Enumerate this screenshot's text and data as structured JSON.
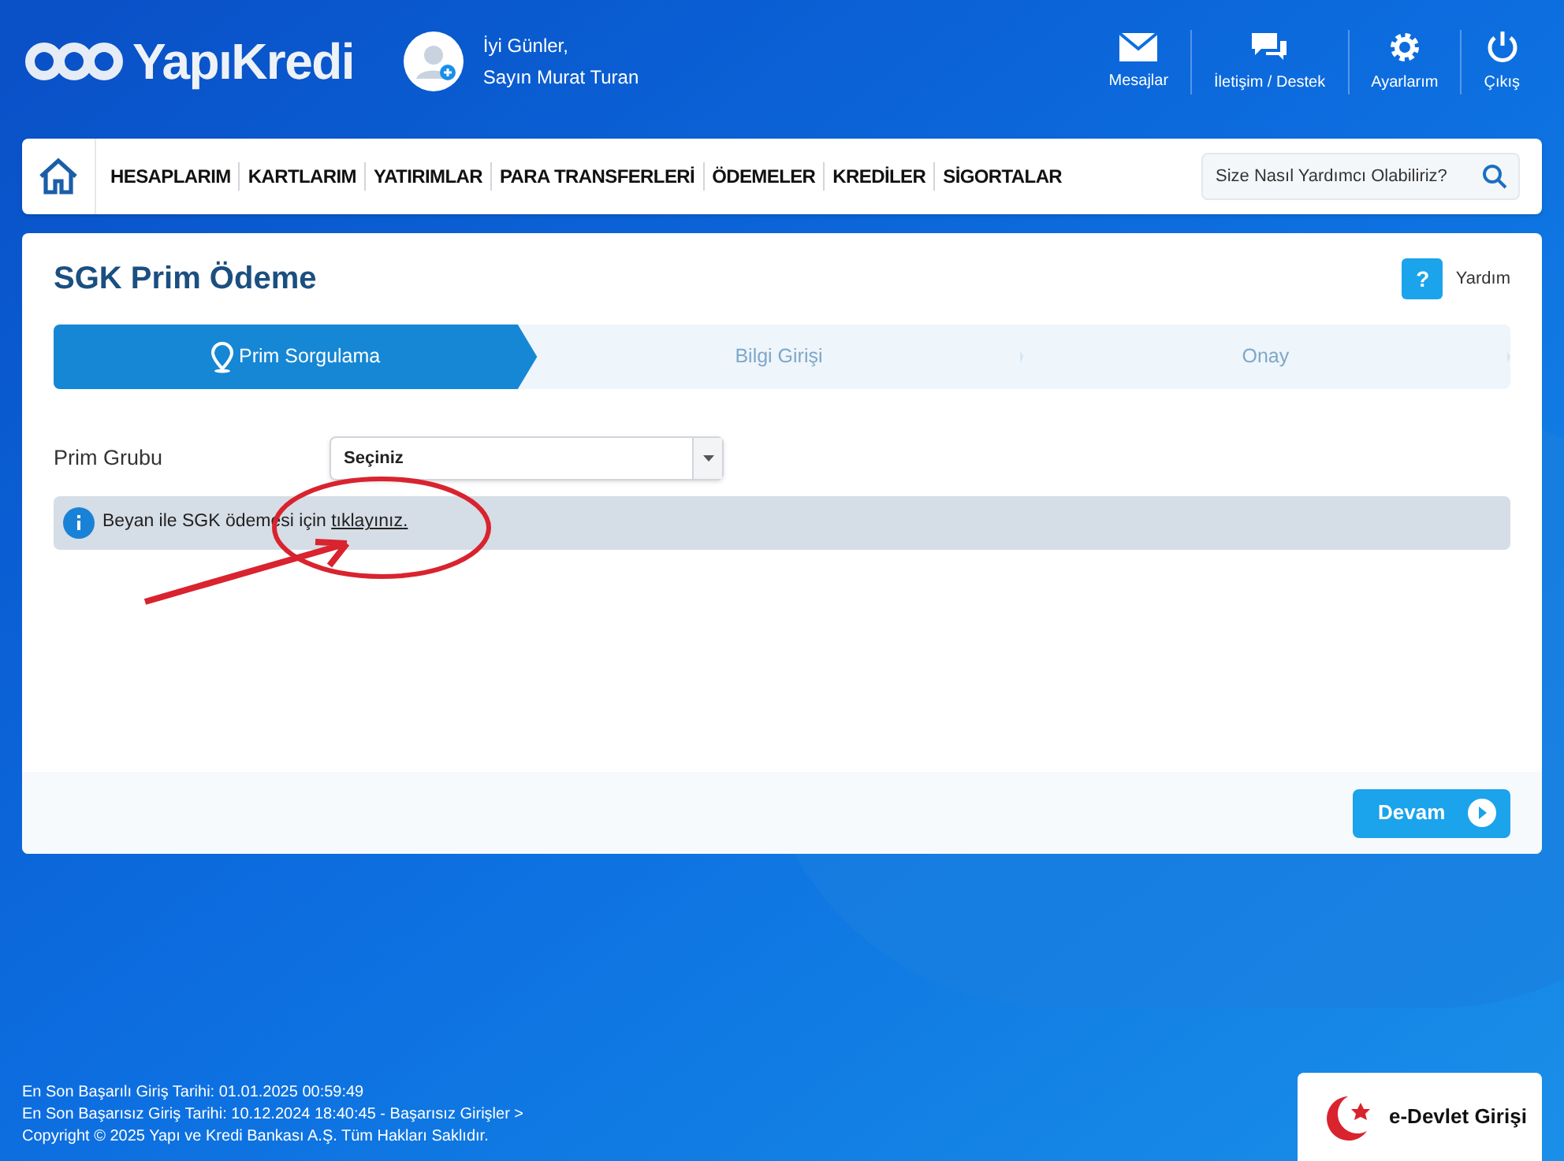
{
  "header": {
    "logo": "YapıKredi",
    "greeting": "İyi Günler,",
    "user_name": "Sayın Murat Turan",
    "actions": [
      {
        "kind": "mail",
        "label": "Mesajlar"
      },
      {
        "kind": "chat",
        "label": "İletişim / Destek"
      },
      {
        "kind": "settings",
        "label": "Ayarlarım"
      },
      {
        "kind": "power",
        "label": "Çıkış"
      }
    ]
  },
  "nav": {
    "items": [
      "HESAPLARIM",
      "KARTLARIM",
      "YATIRIMLAR",
      "PARA TRANSFERLERİ",
      "ÖDEMELER",
      "KREDİLER",
      "SİGORTALAR"
    ],
    "search": {
      "placeholder": "Size Nasıl Yardımcı Olabiliriz?"
    }
  },
  "page": {
    "title": "SGK Prim Ödeme",
    "help_icon": "?",
    "help": "Yardım",
    "steps": [
      {
        "label": "Prim Sorgulama",
        "selected": true
      },
      {
        "label": "Bilgi Girişi",
        "selected": false
      },
      {
        "label": "Onay",
        "selected": false
      }
    ],
    "field": {
      "label": "Prim Grubu",
      "value": "Seçiniz"
    },
    "info": {
      "text": "Beyan ile SGK ödemesi için",
      "link": "tıklayınız."
    },
    "continue": "Devam"
  },
  "footer": {
    "lines": [
      "En Son Başarılı Giriş Tarihi: 01.01.2025 00:59:49",
      "En Son Başarısız Giriş Tarihi: 10.12.2024 18:40:45 - Başarısız Girişler >",
      "Copyright © 2025 Yapı ve Kredi Bankası A.Ş. Tüm Hakları Saklıdır."
    ],
    "edevlet": "e-Devlet Girişi"
  }
}
